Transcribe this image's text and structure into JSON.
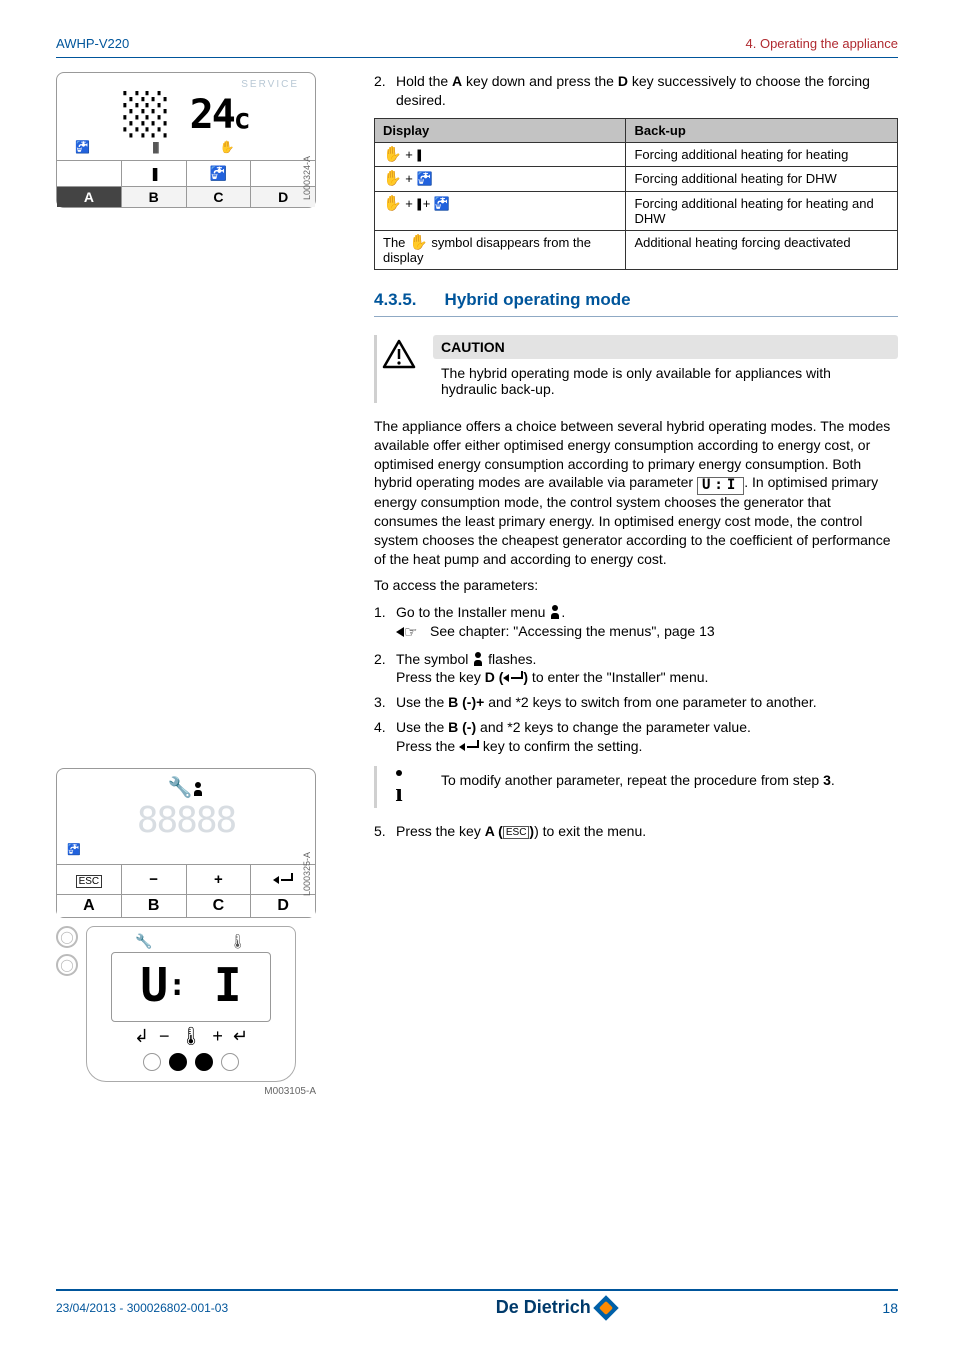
{
  "header": {
    "left": "AWHP-V220",
    "right": "4.  Operating the appliance"
  },
  "step2_intro": "Hold the **A** key down and press the **D** key successively to choose the forcing desired.",
  "table": {
    "headers": [
      "Display",
      "Back-up"
    ],
    "rows": [
      {
        "display_glyphs": [
          "hand",
          "plus",
          "heater"
        ],
        "backup": "Forcing additional heating for heating"
      },
      {
        "display_glyphs": [
          "hand",
          "plus",
          "tap"
        ],
        "backup": "Forcing additional heating for DHW"
      },
      {
        "display_glyphs": [
          "hand",
          "plus",
          "heater",
          "plus",
          "tap"
        ],
        "backup": "Forcing additional heating for heating and DHW"
      },
      {
        "display_text_pre": "The ",
        "display_text_post": " symbol disappears from the display",
        "display_glyph_mid": "hand",
        "backup": "Additional heating forcing deactivated"
      }
    ]
  },
  "section": {
    "number": "4.3.5.",
    "title": "Hybrid operating mode"
  },
  "caution": {
    "title": "CAUTION",
    "body": "The hybrid operating mode is only available for appliances with hydraulic back-up."
  },
  "main_para": "The appliance offers a choice between several hybrid operating modes. The modes available offer either optimised energy consumption according to energy cost, or optimised energy consumption according to primary energy consumption. Both hybrid operating modes are available via parameter ",
  "main_para_param": "U:I",
  "main_para_after": ". In optimised primary energy consumption mode, the control system chooses the generator that consumes the least primary energy. In optimised energy cost mode, the control system chooses the cheapest generator according to the coefficient of performance of the heat pump and according to energy cost.",
  "access_intro": "To access the parameters:",
  "steps": {
    "s1": "Go to the Installer menu ",
    "s1_link": "See chapter:  \"Accessing the menus\", page 13",
    "s2a": "The symbol ",
    "s2b": " flashes.",
    "s2c_pre": "Press the key ",
    "s2c_key": "D (",
    "s2c_post": ") to enter the \"Installer\" menu.",
    "s3": "Use the **B (-)+** and *2 keys to switch from one parameter to another.",
    "s4a": "Use the **B (-)** and *2 keys to change the parameter value.",
    "s4b_pre": "Press the ",
    "s4b_post": " key to confirm the setting."
  },
  "info_note": "To modify another parameter, repeat the procedure from step **3**.",
  "step5_pre": "Press the key ",
  "step5_key": "A (",
  "step5_post": ") to exit the menu.",
  "fig1": {
    "service": "SERVICE",
    "seg": "▯▯ 24c",
    "abcd": [
      "A",
      "B",
      "C",
      "D"
    ],
    "label": "L000324-A"
  },
  "fig2": {
    "seg": "88888",
    "btns": [
      "ESC",
      "−",
      "+",
      "↲"
    ],
    "abcd": [
      "A",
      "B",
      "C",
      "D"
    ],
    "label": "L000325-A",
    "detail_disp": "U: I",
    "detail_ref": "M003105-A"
  },
  "footer": {
    "left": "23/04/2013 - 300026802-001-03",
    "brand": "De Dietrich",
    "page": "18"
  }
}
